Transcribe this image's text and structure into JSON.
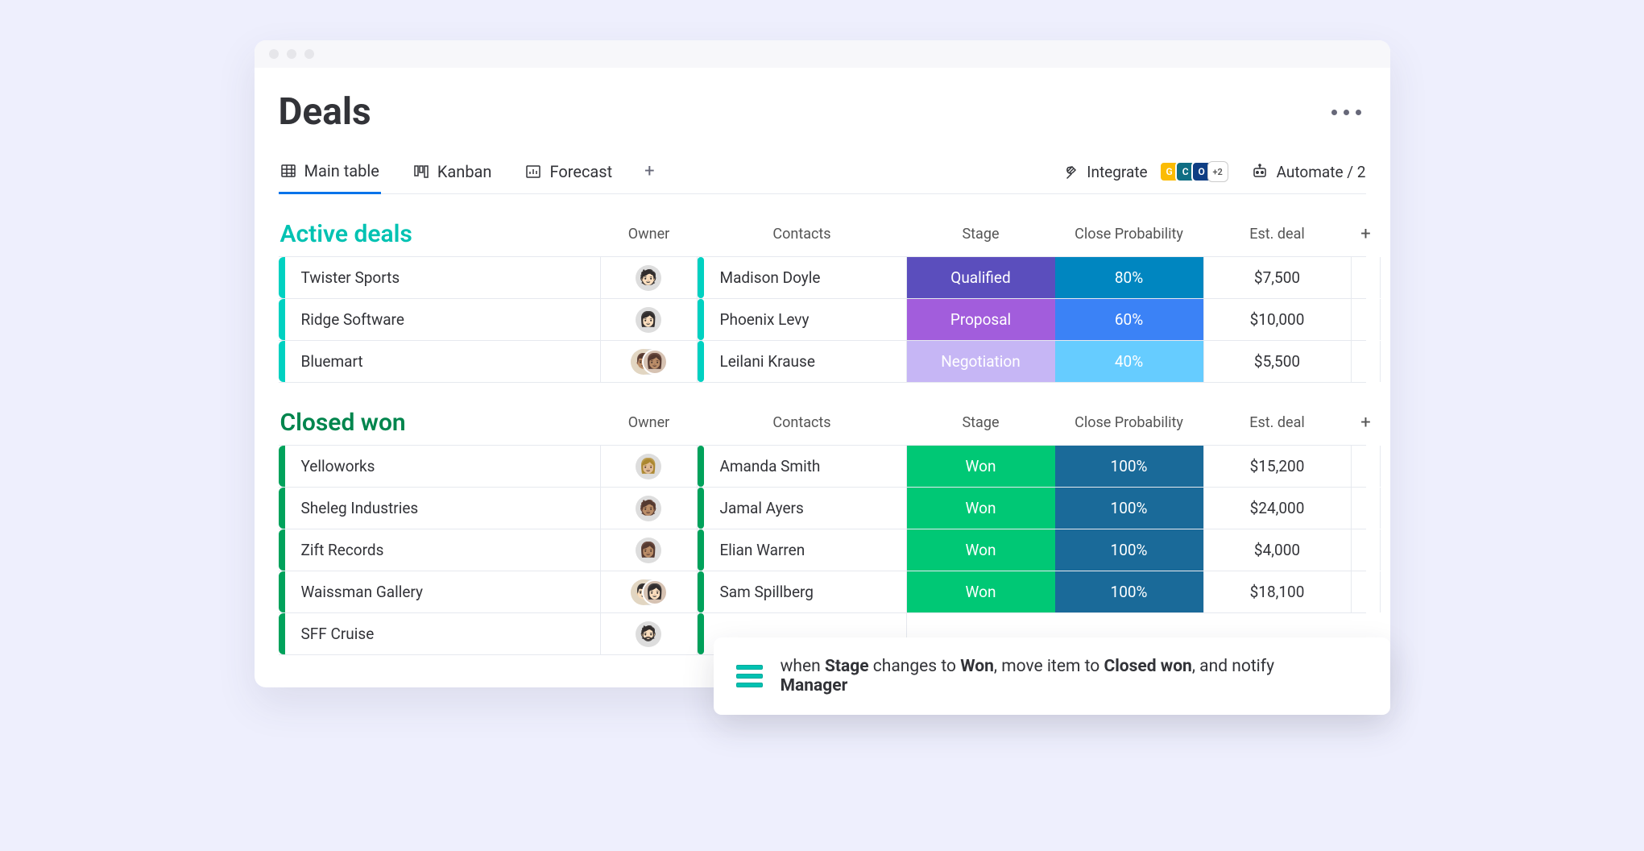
{
  "page": {
    "title": "Deals"
  },
  "views": {
    "main_table": "Main table",
    "kanban": "Kanban",
    "forecast": "Forecast"
  },
  "toolbar": {
    "integrate": "Integrate",
    "integrate_extra": "+2",
    "automate": "Automate / 2"
  },
  "columns": {
    "owner": "Owner",
    "contacts": "Contacts",
    "stage": "Stage",
    "close_probability": "Close Probability",
    "est_deal": "Est. deal"
  },
  "groups": {
    "active": {
      "title": "Active deals",
      "rows": [
        {
          "name": "Twister Sports",
          "contact": "Madison Doyle",
          "stage": "Qualified",
          "prob": "80%",
          "est": "$7,500",
          "stage_class": "stage-qualified",
          "prob_class": "prob-80",
          "owner_pair": false
        },
        {
          "name": "Ridge Software",
          "contact": "Phoenix Levy",
          "stage": "Proposal",
          "prob": "60%",
          "est": "$10,000",
          "stage_class": "stage-proposal",
          "prob_class": "prob-60",
          "owner_pair": false
        },
        {
          "name": "Bluemart",
          "contact": "Leilani Krause",
          "stage": "Negotiation",
          "prob": "40%",
          "est": "$5,500",
          "stage_class": "stage-negotiation",
          "prob_class": "prob-40",
          "owner_pair": true
        }
      ]
    },
    "won": {
      "title": "Closed won",
      "rows": [
        {
          "name": "Yelloworks",
          "contact": "Amanda Smith",
          "stage": "Won",
          "prob": "100%",
          "est": "$15,200",
          "stage_class": "stage-won",
          "prob_class": "prob-100",
          "owner_pair": false
        },
        {
          "name": "Sheleg Industries",
          "contact": "Jamal Ayers",
          "stage": "Won",
          "prob": "100%",
          "est": "$24,000",
          "stage_class": "stage-won",
          "prob_class": "prob-100",
          "owner_pair": false
        },
        {
          "name": "Zift Records",
          "contact": "Elian Warren",
          "stage": "Won",
          "prob": "100%",
          "est": "$4,000",
          "stage_class": "stage-won",
          "prob_class": "prob-100",
          "owner_pair": false
        },
        {
          "name": "Waissman Gallery",
          "contact": "Sam Spillberg",
          "stage": "Won",
          "prob": "100%",
          "est": "$18,100",
          "stage_class": "stage-won",
          "prob_class": "prob-100",
          "owner_pair": true
        },
        {
          "name": "SFF Cruise",
          "contact": "",
          "stage": "",
          "prob": "",
          "est": "",
          "stage_class": "",
          "prob_class": "",
          "owner_pair": false
        }
      ]
    }
  },
  "automation": {
    "prefix": "when ",
    "stage_word": "Stage",
    "mid1": " changes to ",
    "won_word": "Won",
    "mid2": ", move item to ",
    "closed_won_word": "Closed won",
    "mid3": ", and notify ",
    "manager_word": "Manager"
  }
}
